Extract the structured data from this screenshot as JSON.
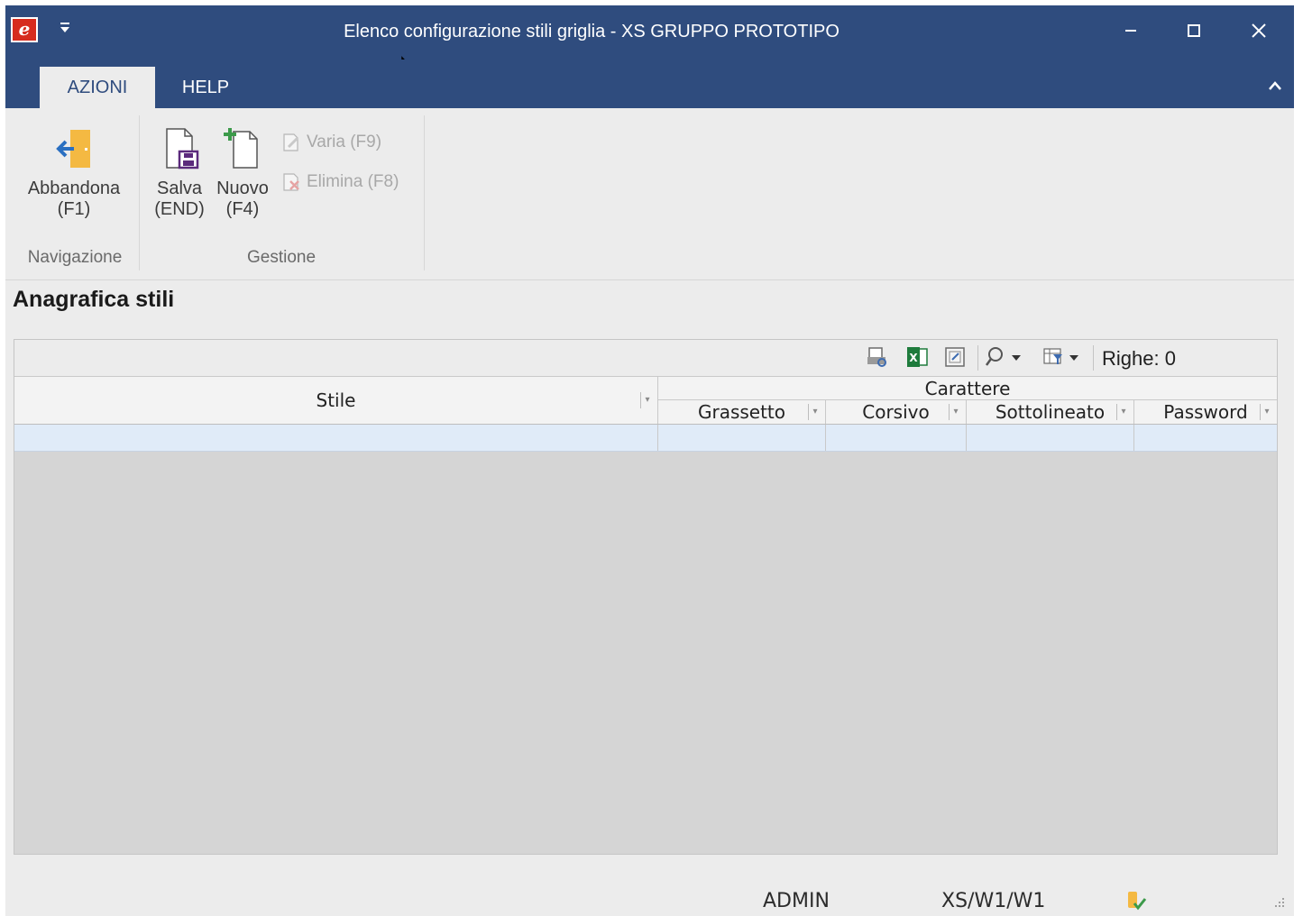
{
  "window": {
    "title": "Elenco configurazione stili griglia - XS  GRUPPO PROTOTIPO",
    "app_logo": "e",
    "qat_icon": "quick-access-menu-icon"
  },
  "ribbon": {
    "tabs": [
      {
        "label": "AZIONI",
        "active": true
      },
      {
        "label": "HELP",
        "active": false
      }
    ],
    "groups": {
      "navigazione": {
        "label": "Navigazione",
        "buttons": [
          {
            "label": "Abbandona\n(F1)",
            "icon": "exit-door-icon"
          }
        ]
      },
      "gestione": {
        "label": "Gestione",
        "buttons": [
          {
            "label": "Salva\n(END)",
            "icon": "save-document-icon"
          },
          {
            "label": "Nuovo\n(F4)",
            "icon": "new-document-icon"
          }
        ],
        "small_buttons": [
          {
            "label": "Varia (F9)",
            "icon": "edit-document-icon",
            "enabled": false
          },
          {
            "label": "Elimina (F8)",
            "icon": "delete-document-icon",
            "enabled": false
          }
        ]
      }
    }
  },
  "section": {
    "title": "Anagrafica stili"
  },
  "grid": {
    "rows_label": "Righe: 0",
    "columns": {
      "stile": "Stile",
      "group_carattere": "Carattere",
      "grassetto": "Grassetto",
      "corsivo": "Corsivo",
      "sottolineato": "Sottolineato",
      "password": "Password"
    }
  },
  "status": {
    "user": "ADMIN",
    "path": "XS/W1/W1"
  },
  "colors": {
    "titlebar": "#2f4c7e",
    "accent_orange": "#f4b942",
    "row_highlight": "#e0ebf8"
  }
}
